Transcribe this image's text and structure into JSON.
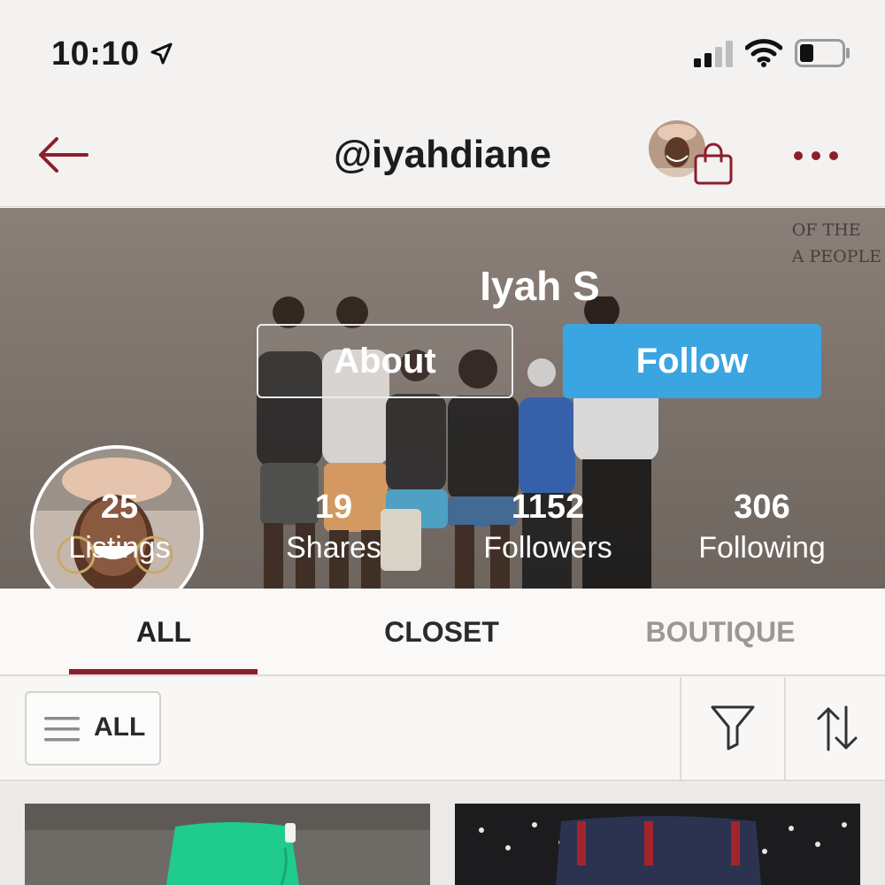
{
  "status_bar": {
    "time": "10:10",
    "icons": [
      "location-arrow-icon",
      "signal-icon",
      "wifi-icon",
      "battery-icon"
    ]
  },
  "nav": {
    "title": "@iyahdiane",
    "icons": [
      "back-arrow-icon",
      "shopping-bag-icon",
      "more-icon"
    ]
  },
  "profile": {
    "display_name": "Iyah S",
    "about_label": "About",
    "follow_label": "Follow",
    "cover_text": [
      "OF THE",
      "A PEOPLE"
    ],
    "stats": [
      {
        "value": "25",
        "label": "Listings"
      },
      {
        "value": "19",
        "label": "Shares"
      },
      {
        "value": "1152",
        "label": "Followers"
      },
      {
        "value": "306",
        "label": "Following"
      }
    ]
  },
  "tabs": [
    {
      "label": "ALL",
      "active": true
    },
    {
      "label": "CLOSET",
      "active": false
    },
    {
      "label": "BOUTIQUE",
      "active": false
    }
  ],
  "filter_bar": {
    "category_label": "ALL",
    "icons": [
      "hamburger-icon",
      "filter-icon",
      "sort-icon"
    ]
  },
  "colors": {
    "brand": "#8b1f2c",
    "follow_button": "#3aa5e0",
    "background": "#f3f2f1"
  }
}
